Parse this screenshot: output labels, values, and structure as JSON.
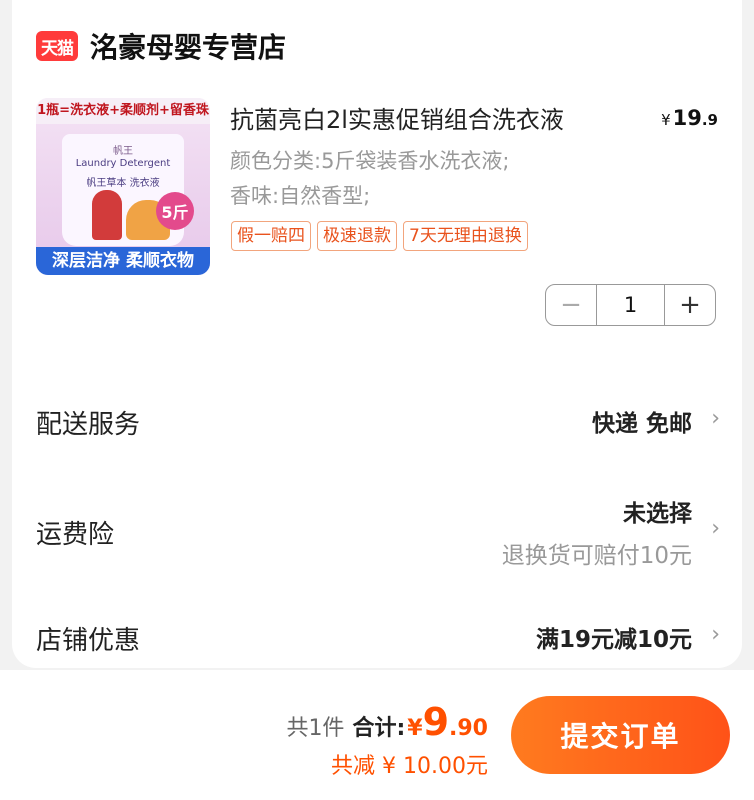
{
  "shop": {
    "badge": "天猫",
    "name": "洺豪母婴专营店"
  },
  "product": {
    "image_top_text": "1瓶=洗衣液+柔顺剂+留香珠",
    "image_brand": "帆王",
    "image_en": "Laundry Detergent",
    "image_cn": "帆王草本 洗衣液",
    "image_badge": "5斤",
    "image_bottom_text": "深层洁净 柔顺衣物",
    "title": "抗菌亮白2l实惠促销组合洗衣液",
    "price": {
      "currency": "¥",
      "int": "19",
      "dec": ".9"
    },
    "spec_line1": "颜色分类:5斤袋装香水洗衣液;",
    "spec_line2": "香味:自然香型;",
    "tags": [
      "假一赔四",
      "极速退款",
      "7天无理由退换"
    ],
    "quantity": "1",
    "minus_symbol": "−",
    "plus_symbol": "+"
  },
  "rows": {
    "delivery": {
      "label": "配送服务",
      "value": "快递 免邮"
    },
    "insurance": {
      "label": "运费险",
      "value": "未选择",
      "sub": "退换货可赔付10元"
    },
    "coupon": {
      "label": "店铺优惠",
      "value": "满19元减10元"
    },
    "chevron": "›"
  },
  "footer": {
    "count": "共1件",
    "total_label": "合计:",
    "currency": "¥",
    "total_int": "9",
    "total_dec": ".90",
    "discount": "共减 ¥ 10.00元",
    "submit_label": "提交订单"
  },
  "colors": {
    "accent": "#ff5000",
    "tag_border": "#f2a57d",
    "tmall_red": "#ff3b3b"
  }
}
